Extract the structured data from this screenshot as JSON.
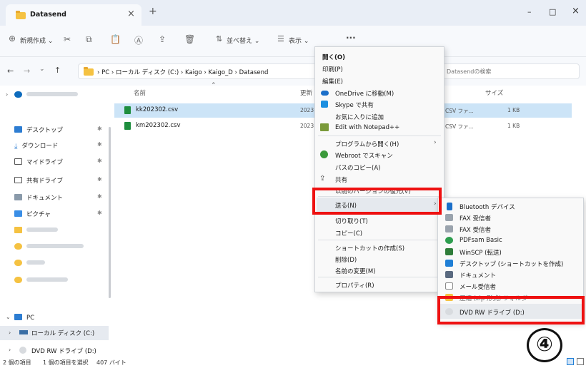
{
  "window": {
    "tab_title": "Datasend",
    "tab_close": "×",
    "new_tab": "+",
    "minimize": "–",
    "maximize": "□",
    "close": "×"
  },
  "toolbar": {
    "new_label": "新規作成",
    "sort_label": "並べ替え",
    "view_label": "表示",
    "more": "···"
  },
  "address": {
    "path": [
      "PC",
      "ローカル ディスク (C:)",
      "Kaigo",
      "Kaigo_D",
      "Datasend"
    ],
    "search_placeholder": "Datasendの検索"
  },
  "nav": {
    "items": [
      "デスクトップ",
      "ダウンロード",
      "マイドライブ",
      "共有ドライブ",
      "ドキュメント",
      "ピクチャ"
    ],
    "pc": "PC",
    "local_disk": "ローカル ディスク (C:)",
    "dvd": "DVD RW ドライブ (D:)"
  },
  "columns": {
    "name": "名前",
    "modified": "更新",
    "size": "サイズ"
  },
  "files": [
    {
      "name": "kk202302.csv",
      "date": "2023",
      "type": "CSV ファ...",
      "size": "1 KB"
    },
    {
      "name": "km202302.csv",
      "date": "2023",
      "type": "CSV ファ...",
      "size": "1 KB"
    }
  ],
  "context_menu": {
    "open": "開く(O)",
    "print": "印刷(P)",
    "edit": "編集(E)",
    "onedrive": "OneDrive に移動(M)",
    "skype": "Skype で共有",
    "favorites": "お気に入りに追加",
    "notepad": "Edit with Notepad++",
    "open_with": "プログラムから開く(H)",
    "webroot": "Webroot でスキャン",
    "copy_path": "パスのコピー(A)",
    "share": "共有",
    "restore": "以前のバージョンの復元(V)",
    "send_to": "送る(N)",
    "cut": "切り取り(T)",
    "copy": "コピー(C)",
    "shortcut": "ショートカットの作成(S)",
    "delete": "削除(D)",
    "rename": "名前の変更(M)",
    "properties": "プロパティ(R)"
  },
  "send_to_menu": {
    "bluetooth": "Bluetooth デバイス",
    "fax1": "FAX 受信者",
    "fax2": "FAX 受信者",
    "pdfsam": "PDFsam Basic",
    "winscp": "WinSCP (転送)",
    "desktop": "デスクトップ (ショートカットを作成)",
    "documents": "ドキュメント",
    "mail": "メール受信者",
    "partial": "圧縮 (zip 形式) フォルダー",
    "dvd": "DVD RW ドライブ (D:)"
  },
  "status": {
    "count": "2 個の項目",
    "selected": "1 個の項目を選択",
    "size": "407 バイト"
  },
  "badge": "④",
  "colors": {
    "highlight": "#ee1111",
    "selected_row": "#cce4f7"
  }
}
